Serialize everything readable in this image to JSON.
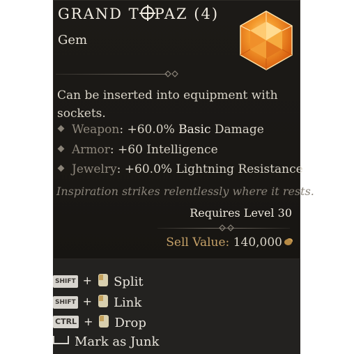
{
  "item": {
    "title": "GRAND T",
    "title_rest": "PAZ (4)",
    "type": "Gem",
    "description": "Can be inserted into equipment with sockets.",
    "effects": [
      {
        "label": "Weapon",
        "text_a": ": +60.0% ",
        "highlight": "Basic",
        "text_b": " Damage"
      },
      {
        "label": "Armor",
        "text_a": ": +60 Intelligence",
        "highlight": "",
        "text_b": ""
      },
      {
        "label": "Jewelry",
        "text_a": ": +60.0% Lightning Resistance",
        "highlight": "",
        "text_b": ""
      }
    ],
    "flavor": "Inspiration strikes relentlessly where it rests.",
    "requirement": "Requires Level 30",
    "sell_label": "Sell Value:",
    "sell_value": "140,000",
    "gem_color": "#f07a1e"
  },
  "actions": [
    {
      "key": "SHIFT",
      "plus": "+",
      "label": "Split"
    },
    {
      "key": "SHIFT",
      "plus": "+",
      "label": "Link"
    },
    {
      "key": "CTRL",
      "plus": "+",
      "label": "Drop"
    },
    {
      "key": "",
      "plus": "",
      "label": "Mark as Junk"
    }
  ],
  "icons": {
    "gem": "topaz-gem-icon",
    "coin": "gold-coin-icon",
    "mouse": "mouse-left-click-icon",
    "spacebar": "spacebar-key-icon"
  }
}
